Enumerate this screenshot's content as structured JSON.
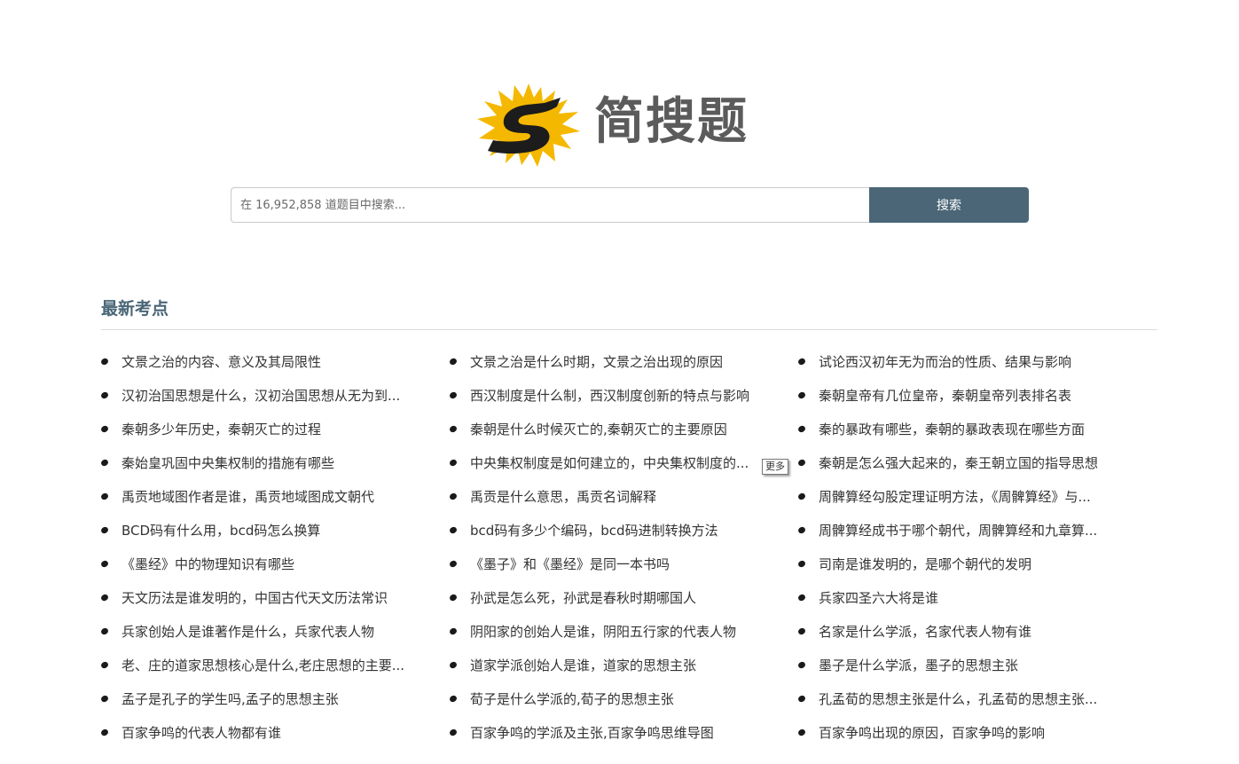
{
  "logo": {
    "text": "简搜题",
    "accent_color": "#f5b800",
    "icon": "s-splash-logo-icon"
  },
  "search": {
    "placeholder": "在 16,952,858 道题目中搜索...",
    "value": "",
    "button_label": "搜索"
  },
  "section": {
    "title": "最新考点"
  },
  "topics": [
    "文景之治的内容、意义及其局限性",
    "文景之治是什么时期，文景之治出现的原因",
    "试论西汉初年无为而治的性质、结果与影响",
    "汉初治国思想是什么，汉初治国思想从无为到...",
    "西汉制度是什么制，西汉制度创新的特点与影响",
    "秦朝皇帝有几位皇帝，秦朝皇帝列表排名表",
    "秦朝多少年历史，秦朝灭亡的过程",
    "秦朝是什么时候灭亡的,秦朝灭亡的主要原因",
    "秦的暴政有哪些，秦朝的暴政表现在哪些方面",
    "秦始皇巩固中央集权制的措施有哪些",
    "中央集权制度是如何建立的，中央集权制度的...",
    "秦朝是怎么强大起来的，秦王朝立国的指导思想",
    "禹贡地域图作者是谁，禹贡地域图成文朝代",
    "禹贡是什么意思，禹贡名词解释",
    "周髀算经勾股定理证明方法，《周髀算经》与...",
    "BCD码有什么用，bcd码怎么换算",
    "bcd码有多少个编码，bcd码进制转换方法",
    "周髀算经成书于哪个朝代，周髀算经和九章算...",
    "《墨经》中的物理知识有哪些",
    "《墨子》和《墨经》是同一本书吗",
    "司南是谁发明的，是哪个朝代的发明",
    "天文历法是谁发明的，中国古代天文历法常识",
    "孙武是怎么死，孙武是春秋时期哪国人",
    "兵家四圣六大将是谁",
    "兵家创始人是谁著作是什么，兵家代表人物",
    "阴阳家的创始人是谁，阴阳五行家的代表人物",
    "名家是什么学派，名家代表人物有谁",
    "老、庄的道家思想核心是什么,老庄思想的主要...",
    "道家学派创始人是谁，道家的思想主张",
    "墨子是什么学派，墨子的思想主张",
    "孟子是孔子的学生吗,孟子的思想主张",
    "荀子是什么学派的,荀子的思想主张",
    "孔孟荀的思想主张是什么，孔孟荀的思想主张...",
    "百家争鸣的代表人物都有谁",
    "百家争鸣的学派及主张,百家争鸣思维导图",
    "百家争鸣出现的原因，百家争鸣的影响"
  ],
  "tooltip": {
    "text": "更多"
  }
}
